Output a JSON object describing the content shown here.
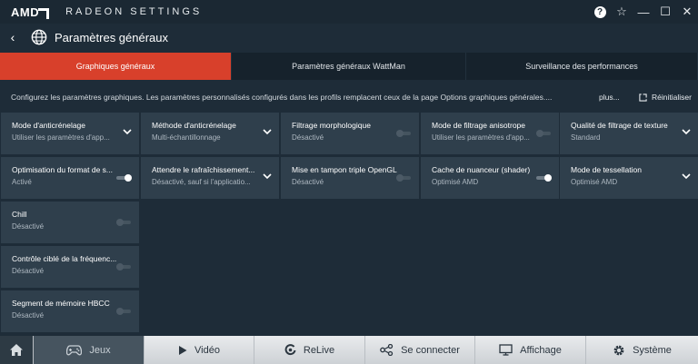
{
  "app": {
    "brand": "AMD",
    "name": "RADEON SETTINGS"
  },
  "window_controls": {
    "help": "?",
    "favorite": "☆",
    "minimize": "—",
    "maximize": "☐",
    "close": "✕"
  },
  "header": {
    "back": "‹",
    "title": "Paramètres généraux"
  },
  "tabs": [
    {
      "label": "Graphiques généraux",
      "active": true
    },
    {
      "label": "Paramètres généraux WattMan",
      "active": false
    },
    {
      "label": "Surveillance des performances",
      "active": false
    }
  ],
  "info": {
    "text": "Configurez les paramètres graphiques. Les paramètres personnalisés configurés dans les profils remplacent ceux de la page Options graphiques générales....",
    "more": "plus...",
    "reset": "Réinitialiser"
  },
  "settings": [
    {
      "label": "Mode d'anticrénelage",
      "value": "Utiliser les paramètres d'app...",
      "control": "dropdown"
    },
    {
      "label": "Méthode d'anticrénelage",
      "value": "Multi-échantillonnage",
      "control": "dropdown"
    },
    {
      "label": "Filtrage morphologique",
      "value": "Désactivé",
      "control": "toggle",
      "on": false
    },
    {
      "label": "Mode de filtrage anisotrope",
      "value": "Utiliser les paramètres d'app...",
      "control": "toggle",
      "on": false
    },
    {
      "label": "Qualité de filtrage de texture",
      "value": "Standard",
      "control": "dropdown"
    },
    {
      "label": "Optimisation du format de s...",
      "value": "Activé",
      "control": "toggle",
      "on": true
    },
    {
      "label": "Attendre le rafraîchissement...",
      "value": "Désactivé, sauf si l'applicatio...",
      "control": "dropdown"
    },
    {
      "label": "Mise en tampon triple OpenGL",
      "value": "Désactivé",
      "control": "toggle",
      "on": false
    },
    {
      "label": "Cache de nuanceur (shader)",
      "value": "Optimisé AMD",
      "control": "toggle",
      "on": true
    },
    {
      "label": "Mode de tessellation",
      "value": "Optimisé AMD",
      "control": "dropdown"
    },
    {
      "label": "Chill",
      "value": "Désactivé",
      "control": "toggle",
      "on": false
    },
    {
      "label": "Contrôle ciblé de la fréquenc...",
      "value": "Désactivé",
      "control": "toggle",
      "on": false
    },
    {
      "label": "Segment de mémoire HBCC",
      "value": "Désactivé",
      "control": "toggle",
      "on": false
    }
  ],
  "nav": [
    {
      "label": "Jeux",
      "icon": "gamepad-icon",
      "active": true
    },
    {
      "label": "Vidéo",
      "icon": "play-icon",
      "active": false
    },
    {
      "label": "ReLive",
      "icon": "relive-icon",
      "active": false
    },
    {
      "label": "Se connecter",
      "icon": "connect-icon",
      "active": false
    },
    {
      "label": "Affichage",
      "icon": "monitor-icon",
      "active": false
    },
    {
      "label": "Système",
      "icon": "gear-icon",
      "active": false
    }
  ],
  "colors": {
    "accent": "#d8402b",
    "background": "#1e2c38",
    "tile": "#2f3f4c"
  }
}
